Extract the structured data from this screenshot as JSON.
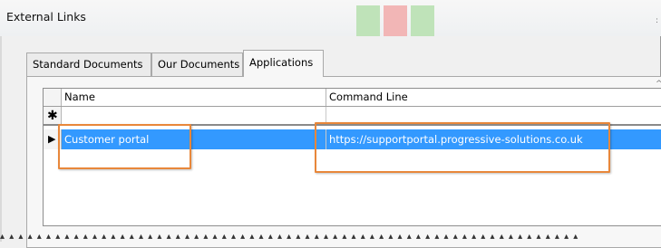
{
  "window": {
    "title": "External Links"
  },
  "tabs": [
    {
      "label": "Standard Documents",
      "active": false
    },
    {
      "label": "Our Documents",
      "active": false
    },
    {
      "label": "Applications",
      "active": true
    }
  ],
  "grid": {
    "columns": [
      "Name",
      "Command Line"
    ],
    "new_row_marker": "✱",
    "current_row_marker": "▶",
    "rows": [
      {
        "name": "Customer portal",
        "command_line": "https://supportportal.progressive-solutions.co.uk",
        "selected": true
      }
    ]
  },
  "colors": {
    "selection": "#3399ff",
    "highlight": "#e8873a"
  }
}
